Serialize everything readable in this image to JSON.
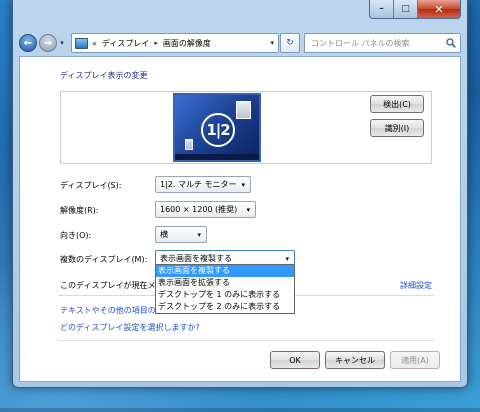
{
  "window": {
    "caption_buttons": {
      "minimize": "–",
      "maximize": "□",
      "close": "✕"
    }
  },
  "navbar": {
    "address": {
      "chevron": "«",
      "crumbs": [
        "ディスプレイ",
        "画面の解像度"
      ],
      "separator": "▸",
      "dropdown_arrow": "▾"
    },
    "refresh_glyph": "↻",
    "search": {
      "placeholder": "コントロール パネルの検索"
    },
    "icons": {
      "back": "back-arrow-icon",
      "forward": "forward-arrow-icon",
      "search": "search-icon"
    }
  },
  "content": {
    "section_title": "ディスプレイ表示の変更",
    "preview": {
      "monitor_label": "1|2"
    },
    "buttons": {
      "detect": "検出(C)",
      "identify": "識別(I)",
      "ok": "OK",
      "cancel": "キャンセル",
      "apply": "適用(A)"
    },
    "fields": {
      "display": {
        "label": "ディスプレイ(S):",
        "value": "1|2. マルチ モニター"
      },
      "resolution": {
        "label": "解像度(R):",
        "value": "1600 × 1200 (推奨)"
      },
      "orientation": {
        "label": "向き(O):",
        "value": "横"
      },
      "multiple_displays": {
        "label": "複数のディスプレイ(M):",
        "value": "表示画面を複製する",
        "options": [
          "表示画面を複製する",
          "表示画面を拡張する",
          "デスクトップを 1 のみに表示する",
          "デスクトップを 2 のみに表示する"
        ],
        "selected_index": 0
      }
    },
    "status_text": "このディスプレイが現在メ",
    "links": {
      "advanced": "詳細設定",
      "text_size": "テキストやその他の項目の",
      "which_setting": "どのディスプレイ設定を選択しますか?"
    }
  },
  "colors": {
    "link": "#1a4fd1",
    "title": "#1e3287",
    "selection": "#3399ff",
    "monitor": "#1a3d8f"
  }
}
